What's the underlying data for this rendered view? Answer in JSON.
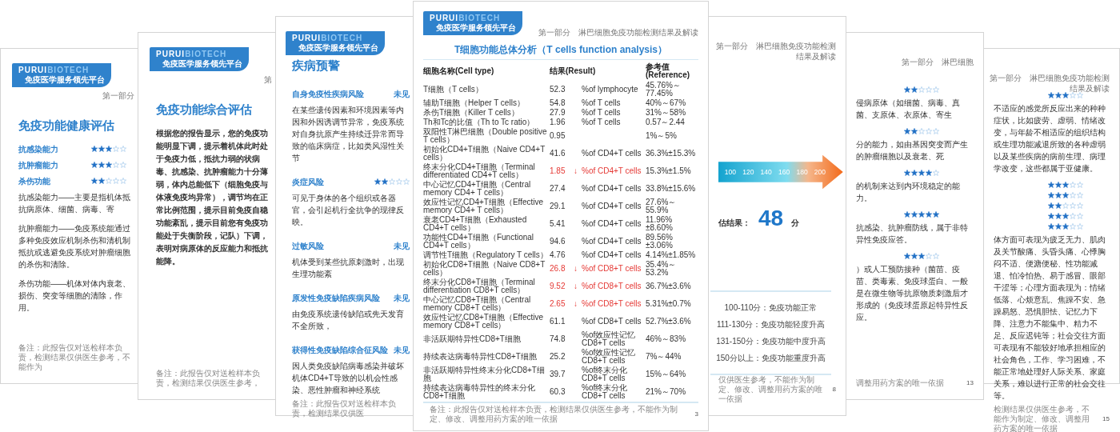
{
  "pages": [
    {
      "logo": {
        "wordmark": [
          "PURUI",
          "BIOTECH"
        ],
        "tagline": "免疫医学服务领先平台"
      },
      "header": "第一部分",
      "title": "免疫功能健康评估",
      "blocks": [
        {
          "kind": "rating",
          "label": "抗感染能力",
          "stars": 3
        },
        {
          "kind": "rating",
          "label": "抗肿瘤能力",
          "stars": 3
        },
        {
          "kind": "rating",
          "label": "杀伤功能",
          "stars": 2
        },
        {
          "kind": "paragraph",
          "text": "抗感染能力——主要是指机体抵抗病原体、细菌、病毒、寄"
        },
        {
          "kind": "paragraph",
          "text": "抗肿瘤能力——免疫系统能通过多种免疫效应机制杀伤和清机制抵抗或逃避免疫系统对肿瘤细胞的杀伤和清除。"
        },
        {
          "kind": "paragraph",
          "text": "杀伤功能——机体对体内衰老、损伤、突变等细胞的清除，作用。"
        }
      ],
      "footer": "备注：此报告仅对送检样本负责，检测结果仅供医生参考，不能作为"
    },
    {
      "logo": {
        "wordmark": [
          "PURUI",
          "BIOTECH"
        ],
        "tagline": "免疫医学服务领先平台"
      },
      "header": "第",
      "title": "免疫功能综合评估",
      "blocks": [
        {
          "kind": "paragraph",
          "text": "根据您的报告显示，您的免疫功能明显下调，提示着机体此时处于免疫力低，抵抗力弱的状病毒、抗感染、抗肿瘤能力十分薄弱，体内总能低下（细胞免疫与体液免疫均异常），调节均在正常比例范围，提示目前免疫自稳功能紊乱，提示目前您有免疫功能处于失衡阶段，记队）下调，表明对病原体的反应能力和抵抗能降。"
        }
      ],
      "footer": "备注：此报告仅对送检样本负责，检测结果仅供医生参考，"
    },
    {
      "logo": {
        "wordmark": [
          "PURUI",
          "BIOTECH"
        ],
        "tagline": "免疫医学服务领先平台"
      },
      "title": "疾病预警",
      "blocks": [
        {
          "kind": "risk",
          "heading": "自身免疫性疾病风险",
          "status": "未见"
        },
        {
          "kind": "paragraph",
          "text": "在某些遗传因素和环境因素等内因和外因诱调节异常，免疫系统对自身抗原产生持续迁异常而导致的临床病症，比如类风湿性关节"
        },
        {
          "kind": "risk",
          "heading": "炎症风险",
          "stars": 2
        },
        {
          "kind": "paragraph",
          "text": "可见于身体的各个组织或各器官，会引起机行全抗争的现律反映。"
        },
        {
          "kind": "risk",
          "heading": "过敏风险",
          "status": "未见"
        },
        {
          "kind": "paragraph",
          "text": "机体受到某些抗原刺激时，出现生理功能紊"
        },
        {
          "kind": "risk",
          "heading": "原发性免疫缺陷疾病风险",
          "status": "未见"
        },
        {
          "kind": "paragraph",
          "text": "由免疫系统遗传缺陷或先天发育不全所致，"
        },
        {
          "kind": "risk",
          "heading": "获得性免疫缺陷综合征风险",
          "status": "未见"
        },
        {
          "kind": "paragraph",
          "text": "因人类免疫缺陷病毒感染并破坏机体CD4+T导致的以机会性感染、恶性肿瘤和神经系统"
        }
      ],
      "footer": "备注：此报告仅对送检样本负责，检测结果仅供医"
    },
    {
      "logo": {
        "wordmark": [
          "PURUI",
          "BIOTECH"
        ],
        "tagline": "免疫医学服务领先平台"
      },
      "header": "第一部分　淋巴细胞免疫功能检测结果及解读",
      "title": "T细胞功能总体分析（T cells function analysis）",
      "blocks": [
        {
          "kind": "table",
          "columns": [
            "细胞名称(Cell type)",
            "结果(Result)",
            "参考值(Reference)"
          ],
          "rows": [
            {
              "name": "T细胞（T cells）",
              "result": "52.3",
              "unit": "%of lymphocyte",
              "reference": "45.76%～77.45%",
              "abnormal": false
            },
            {
              "name": "辅助T细胞（Helper T cells）",
              "result": "54.8",
              "unit": "%of T cells",
              "reference": "40%～67%",
              "abnormal": false
            },
            {
              "name": "杀伤T细胞（Killer T cells）",
              "result": "27.9",
              "unit": "%of T cells",
              "reference": "31%～58%",
              "abnormal": false
            },
            {
              "name": "Th和Tc的比值（Th to Tc ratio）",
              "result": "1.96",
              "unit": "%of T cells",
              "reference": "0.57～2.44",
              "abnormal": false
            },
            {
              "name": "双阳性T淋巴细胞（Double positive T cells）",
              "result": "0.95",
              "reference": "1%～5%",
              "abnormal": false
            },
            {
              "name": "初始化CD4+T细胞（Naive CD4+T cells）",
              "result": "41.6",
              "unit": "%of CD4+T cells",
              "reference": "36.3%±15.3%",
              "abnormal": false
            },
            {
              "name": "终末分化CD4+T细胞（Terminal differentiated CD4+T cells）",
              "result": "1.85",
              "flag": "↓",
              "unit": "%of CD4+T cells",
              "reference": "15.3%±1.5%",
              "abnormal": true
            },
            {
              "name": "中心记忆CD4+T细胞（Central memory CD4+ T cells）",
              "result": "27.4",
              "unit": "%of CD4+T cells",
              "reference": "33.8%±15.6%",
              "abnormal": false
            },
            {
              "name": "效应性记忆CD4+T细胞（Effective memory CD4+ T cells）",
              "result": "29.1",
              "unit": "%of CD4+T cells",
              "reference": "27.6%～55.9%",
              "abnormal": false
            },
            {
              "name": "衰老CD4+T细胞（Exhausted CD4+T cells）",
              "result": "5.41",
              "unit": "%of CD4+T cells",
              "reference": "11.96%±8.60%",
              "abnormal": false
            },
            {
              "name": "功能性CD4+T细胞（Functional CD4+T cells）",
              "result": "94.6",
              "unit": "%of CD4+T cells",
              "reference": "89.56%±3.06%",
              "abnormal": false
            },
            {
              "name": "调节性T细胞（Regulatory T cells）",
              "result": "4.76",
              "unit": "%of CD4+T cells",
              "reference": "4.14%±1.85%",
              "abnormal": false
            },
            {
              "name": "初始化CD8+T细胞（Naive CD8+T cells）",
              "result": "26.8",
              "flag": "↓",
              "unit": "%of CD8+T cells",
              "reference": "35.4%～53.2%",
              "abnormal": true
            },
            {
              "name": "终末分化CD8+T细胞（Terminal differentiation CD8+T cells）",
              "result": "9.52",
              "flag": "↓",
              "unit": "%of CD8+T cells",
              "reference": "36.7%±3.6%",
              "abnormal": true
            },
            {
              "name": "中心记忆CD8+T细胞（Central memory CD8+T cells）",
              "result": "2.65",
              "flag": "↓",
              "unit": "%of CD8+T cells",
              "reference": "5.31%±0.7%",
              "abnormal": true
            },
            {
              "name": "效应性记忆CD8+T细胞（Effective memory CD8+T cells）",
              "result": "61.1",
              "unit": "%of CD8+T cells",
              "reference": "52.7%±3.6%",
              "abnormal": false
            },
            {
              "name": "非活跃期特异性CD8+T细胞",
              "result": "74.8",
              "unit": "%of效应性记忆CD8+T cells",
              "reference": "46%～83%",
              "abnormal": false
            },
            {
              "name": "持续表达病毒特异性CD8+T细胞",
              "result": "25.2",
              "unit": "%of效应性记忆CD8+T cells",
              "reference": "7%～44%",
              "abnormal": false
            },
            {
              "name": "非活跃期特异性终末分化CD8+T细胞",
              "result": "39.7",
              "unit": "%of终末分化CD8+T cells",
              "reference": "15%～64%",
              "abnormal": false
            },
            {
              "name": "持续表达病毒特异性的终末分化CD8+T细胞",
              "result": "60.3",
              "unit": "%of终末分化CD8+T cells",
              "reference": "21%～70%",
              "abnormal": false
            }
          ]
        }
      ],
      "footer": "备注：此报告仅对送检样本负责，检测结果仅供医生参考，不能作为制定、修改、调整用药方案的唯一依据",
      "page_number": "3"
    },
    {
      "header": "第一部分　淋巴细胞免疫功能检测结果及解读",
      "blocks": [
        {
          "kind": "gauge",
          "ticks": [
            "100",
            "120",
            "140",
            "160",
            "180",
            "200"
          ]
        },
        {
          "kind": "score",
          "label": "估结果：",
          "value": "48",
          "unit": "分"
        },
        {
          "kind": "legend",
          "items": [
            "100-110分：免疫功能正常",
            "111-130分：免疫功能轻度升高",
            "131-150分：免疫功能中度升高",
            "150分以上：免疫功能重度升高"
          ]
        }
      ],
      "footer": "仅供医生参考，不能作为制定、修改、调整用药方案的唯一依据",
      "page_number": "8"
    },
    {
      "header": "第一部分　淋巴细胞",
      "blocks": [
        {
          "kind": "rating",
          "stars": 2
        },
        {
          "kind": "paragraph",
          "text": "侵病原体（如细菌、病毒、真菌、支原体、衣原体、寄生"
        },
        {
          "kind": "rating",
          "stars": 2
        },
        {
          "kind": "paragraph",
          "text": "分的能力，如由基因突变而产生的肿瘤细胞以及衰老、死"
        },
        {
          "kind": "rating",
          "stars": 4
        },
        {
          "kind": "paragraph",
          "text": "的机制来达到内环境稳定的能力。"
        },
        {
          "kind": "rating",
          "stars": 5
        },
        {
          "kind": "paragraph",
          "text": "抗感染、抗肿瘤防线，属于非特异性免疫应答。"
        },
        {
          "kind": "rating",
          "stars": 3
        },
        {
          "kind": "paragraph",
          "text": "）或人工预防接种（菌苗、疫苗、类毒素、免疫球蛋白、一般是在微生物等抗原物质刺激后才形成的（免疫球蛋原起特异性反应。"
        }
      ],
      "footer": "调整用药方案的唯一依据",
      "page_number": "13"
    },
    {
      "header": "第一部分　淋巴细胞免疫功能检测结果及解读",
      "blocks": [
        {
          "kind": "rating",
          "stars": 3
        },
        {
          "kind": "paragraph",
          "text": "不适应的感觉所反应出来的种种症状，比如疲劳、虚弱、情绪改变，与年龄不相适应的组织结构或生理功能减退所致的各种虚弱以及某些疾病的病前生理、病理学改变，这些都属于亚健康。"
        },
        {
          "kind": "rating",
          "stars": 3
        },
        {
          "kind": "rating",
          "stars": 3
        },
        {
          "kind": "rating",
          "stars": 2
        },
        {
          "kind": "rating",
          "stars": 3
        },
        {
          "kind": "rating",
          "stars": 3
        },
        {
          "kind": "paragraph",
          "text": "体方面可表现为疲乏无力、肌肉及关节酸痛、头昏头痛、心悸胸闷不适、便溏便秘、性功能减退、怕冷怕热、易于感冒、眼部干涩等；心理方面表现为：情绪低落、心烦意乱、焦躁不安、急躁易怒、恐惧胆怯、记忆力下降、注意力不能集中、精力不足、反应迟钝等；社会交往方面可表现有不能较好地承担相应的社会角色，工作、学习困难，不能正常地处理好人际关系、家庭关系，难以进行正常的社会交往等。"
        }
      ],
      "footer": "检测结果仅供医生参考，不能作为制定、修改、调整用药方案的唯一依据",
      "page_number": "15"
    }
  ]
}
